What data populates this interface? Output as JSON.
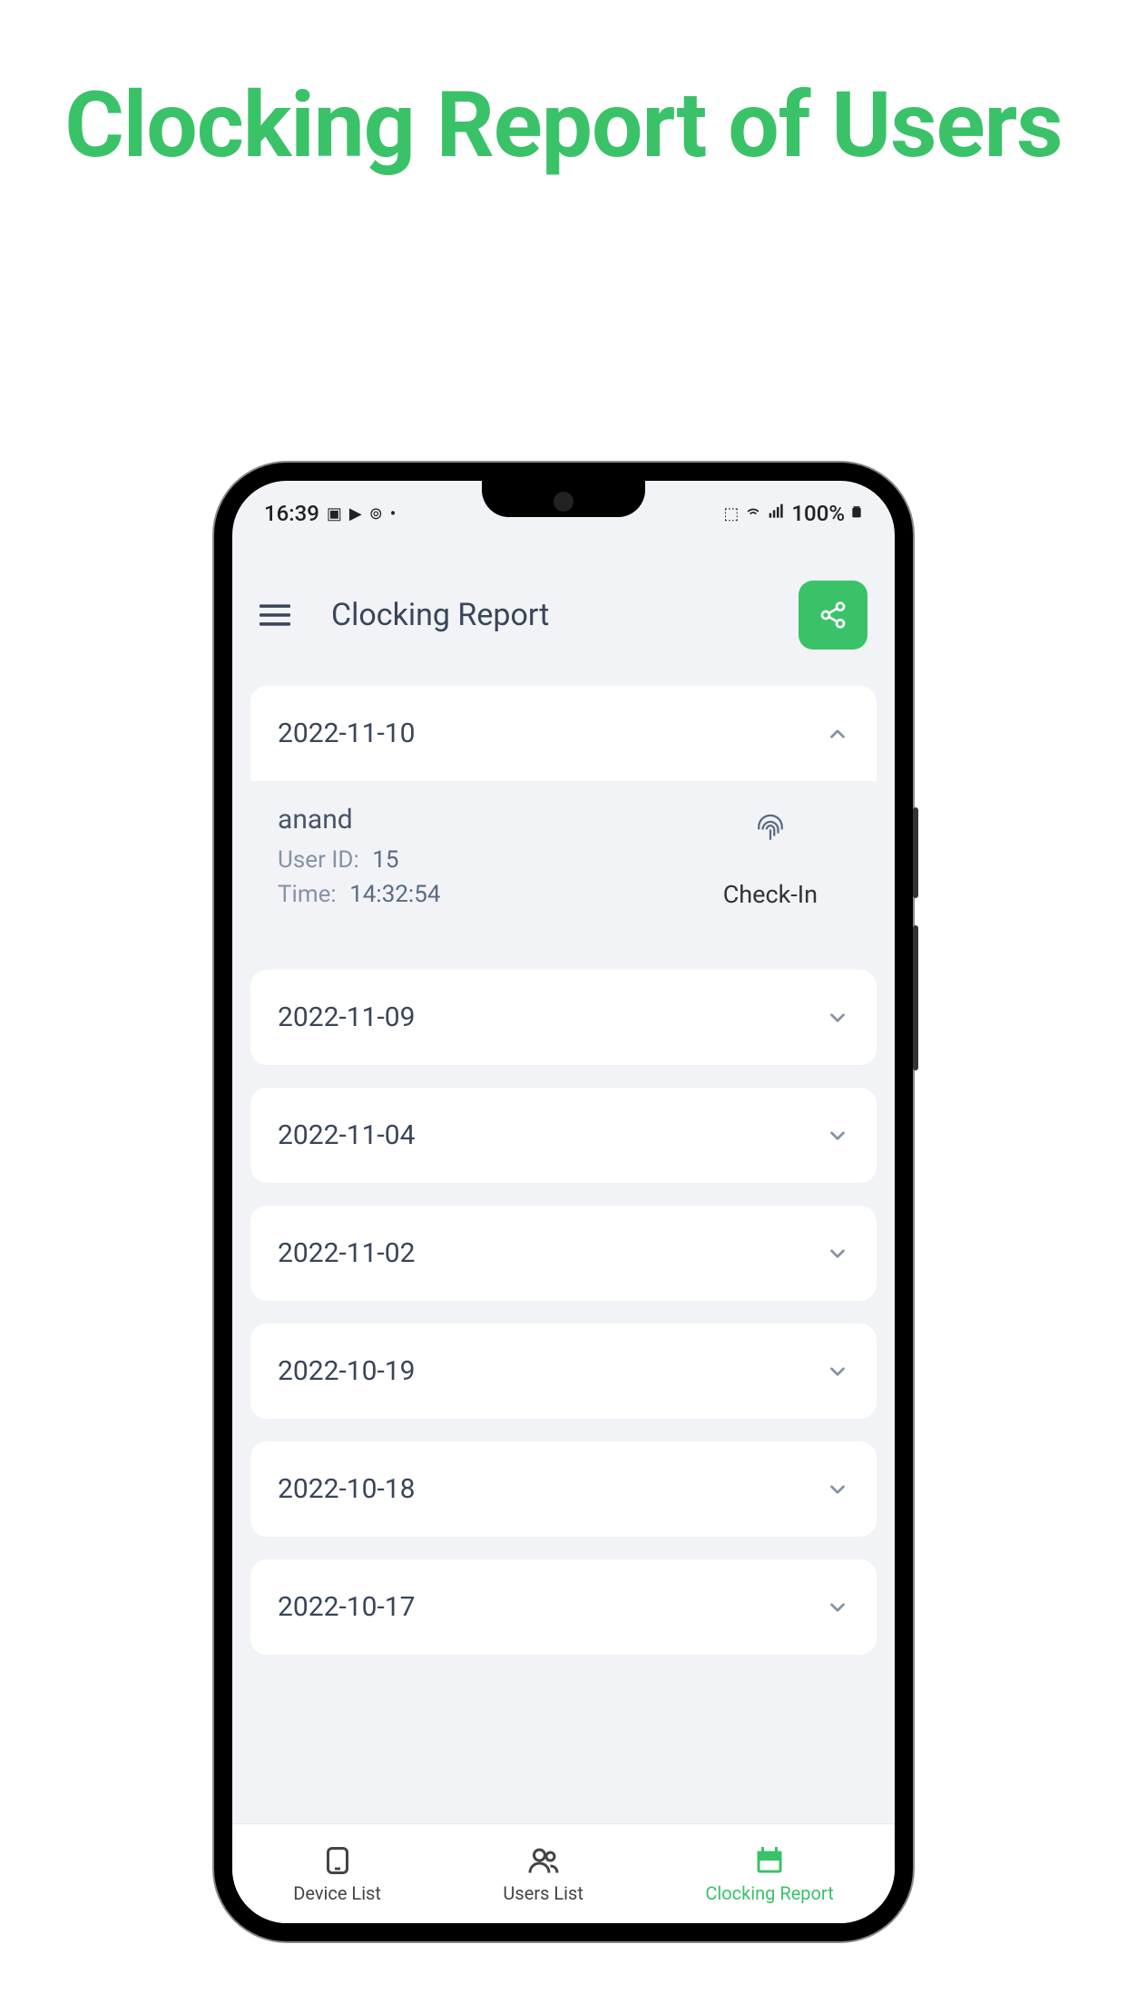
{
  "page_title": "Clocking Report of Users",
  "status_bar": {
    "time": "16:39",
    "battery": "100%"
  },
  "header": {
    "title": "Clocking Report"
  },
  "records": [
    {
      "date": "2022-11-10",
      "expanded": true,
      "detail": {
        "user_name": "anand",
        "user_id_label": "User ID:",
        "user_id": "15",
        "time_label": "Time:",
        "time": "14:32:54",
        "action": "Check-In"
      }
    },
    {
      "date": "2022-11-09",
      "expanded": false
    },
    {
      "date": "2022-11-04",
      "expanded": false
    },
    {
      "date": "2022-11-02",
      "expanded": false
    },
    {
      "date": "2022-10-19",
      "expanded": false
    },
    {
      "date": "2022-10-18",
      "expanded": false
    },
    {
      "date": "2022-10-17",
      "expanded": false
    }
  ],
  "bottom_nav": {
    "device_list": "Device List",
    "users_list": "Users List",
    "clocking_report": "Clocking Report"
  },
  "colors": {
    "accent": "#3AC268"
  }
}
